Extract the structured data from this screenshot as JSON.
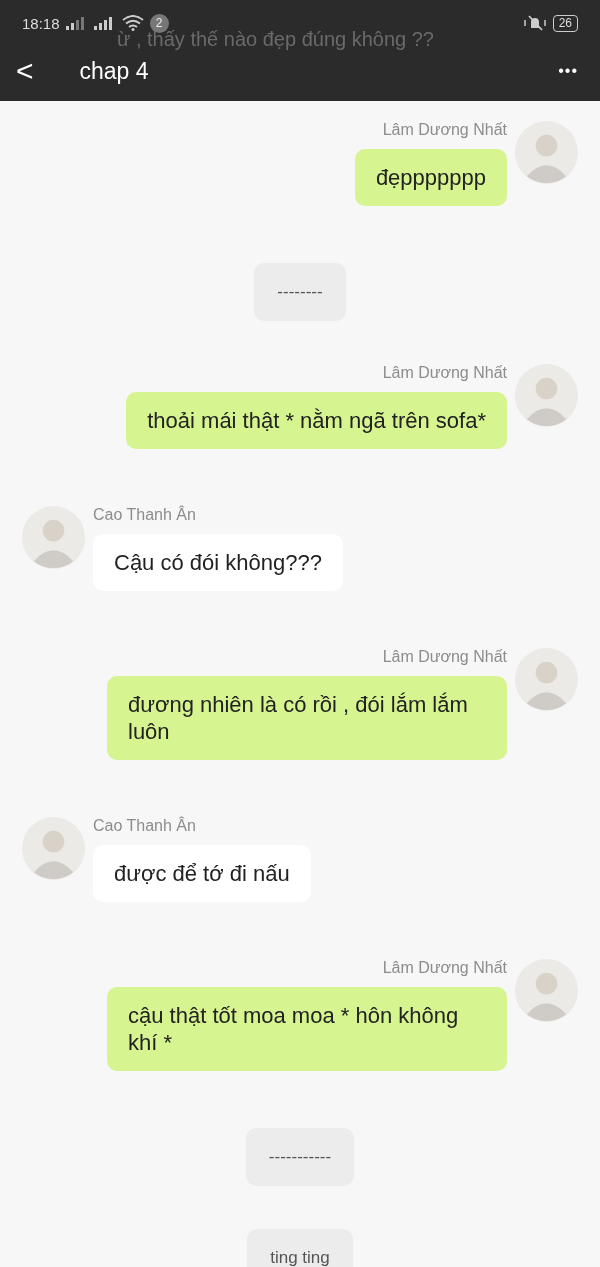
{
  "status_bar": {
    "time": "18:18",
    "notification_count": "2",
    "battery": "26"
  },
  "header": {
    "title": "chap 4",
    "back": "<",
    "menu": "•••",
    "behind_text": "ừ , thấy thế nào đẹp đúng không ??"
  },
  "messages": [
    {
      "kind": "mine",
      "sender": "Lâm Dương Nhất",
      "text": "đẹppppppp"
    },
    {
      "kind": "system",
      "text": "--------"
    },
    {
      "kind": "mine",
      "sender": "Lâm Dương Nhất",
      "text": "thoải mái thật * nằm ngã trên sofa*"
    },
    {
      "kind": "theirs",
      "sender": "Cao Thanh Ân",
      "text": "Cậu có đói không???"
    },
    {
      "kind": "mine",
      "sender": "Lâm Dương Nhất",
      "text": "đương nhiên là có rồi , đói lắm lắm luôn"
    },
    {
      "kind": "theirs",
      "sender": "Cao Thanh Ân",
      "text": "được để tớ đi nấu"
    },
    {
      "kind": "mine",
      "sender": "Lâm Dương Nhất",
      "text": "cậu thật tốt moa moa * hôn không khí *"
    },
    {
      "kind": "system",
      "text": "-----------"
    },
    {
      "kind": "system",
      "text": "ting ting"
    }
  ]
}
